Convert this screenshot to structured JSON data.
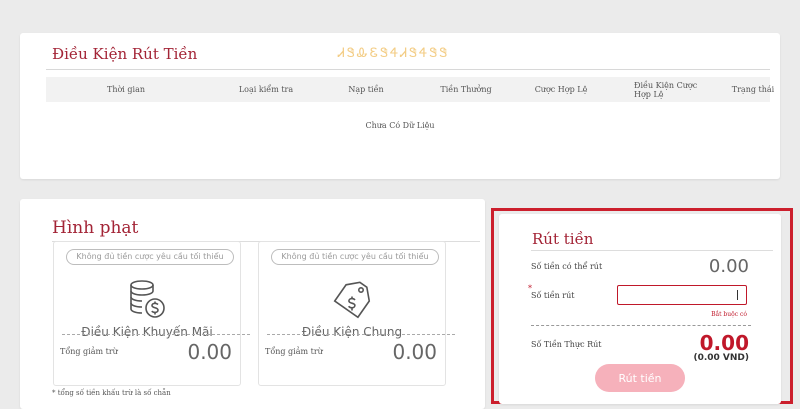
{
  "conditions": {
    "title": "Điều Kiện Rút Tiền",
    "watermark": "ᏗᏕᎲᏋᏕᏎᏗᏕᏎᏕᏕ",
    "columns": [
      "Thời gian",
      "Loại kiểm tra",
      "Nạp tiền",
      "Tiền Thưởng",
      "Cược Hợp Lệ",
      "Điều Kiện Cược Hợp Lệ",
      "Trạng thái"
    ],
    "empty": "Chưa Có Dữ Liệu"
  },
  "penalty": {
    "title": "Hình phạt",
    "boxes": [
      {
        "pill": "Không đủ tiền cược yêu cầu tối thiểu",
        "label": "Điều Kiện Khuyến Mãi",
        "sub": "Tổng giảm trừ",
        "value": "0.00",
        "icon": "coins-dollar-icon"
      },
      {
        "pill": "Không đủ tiền cược yêu cầu tối thiểu",
        "label": "Điều Kiện Chung",
        "sub": "Tổng giảm trừ",
        "value": "0.00",
        "icon": "price-tag-icon"
      }
    ],
    "footnote": "* tổng số tiền khấu trừ là số chẵn"
  },
  "withdraw": {
    "title": "Rút tiền",
    "available_label": "Số tiền có thể rút",
    "available_value": "0.00",
    "amount_label": "Số tiền rút",
    "required_star": "*",
    "required_text": "Bắt buộc có",
    "input_value": "",
    "real_label": "Số Tiền Thực Rút",
    "real_value": "0.00",
    "real_vnd": "(0.00 VND)",
    "button": "Rút tiền"
  },
  "colors": {
    "accent": "#a32436",
    "highlight_border": "#cc1f2d",
    "button": "#f6b1bb"
  }
}
